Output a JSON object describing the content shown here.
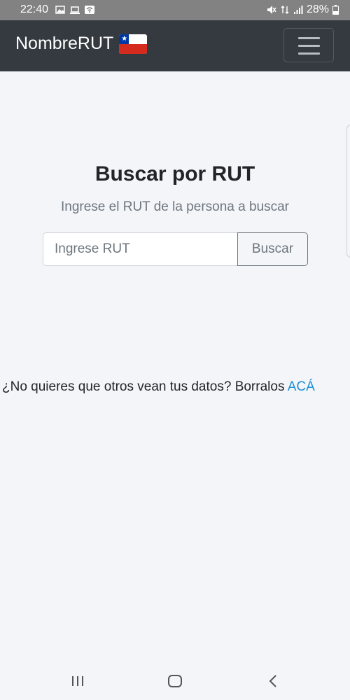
{
  "status_bar": {
    "time": "22:40",
    "battery": "28%",
    "left_icons": [
      "image-icon",
      "laptop-icon",
      "wifi-icon"
    ],
    "right_icons": [
      "mute-icon",
      "data-icon",
      "signal-icon",
      "battery-icon"
    ]
  },
  "navbar": {
    "brand": "NombreRUT",
    "flag_icon": "chile-flag-icon",
    "menu_icon": "hamburger-menu-icon",
    "background": "#343a40"
  },
  "main": {
    "title": "Buscar por RUT",
    "subtitle": "Ingrese el RUT de la persona a buscar",
    "search_placeholder": "Ingrese RUT",
    "search_value": "",
    "search_button": "Buscar"
  },
  "footer": {
    "text": "¿No quieres que otros vean tus datos? Borralos ",
    "link": "ACÁ",
    "link_color": "#1a8fd6"
  },
  "android_nav": {
    "icons": [
      "recent-apps-icon",
      "home-icon",
      "back-icon"
    ]
  }
}
